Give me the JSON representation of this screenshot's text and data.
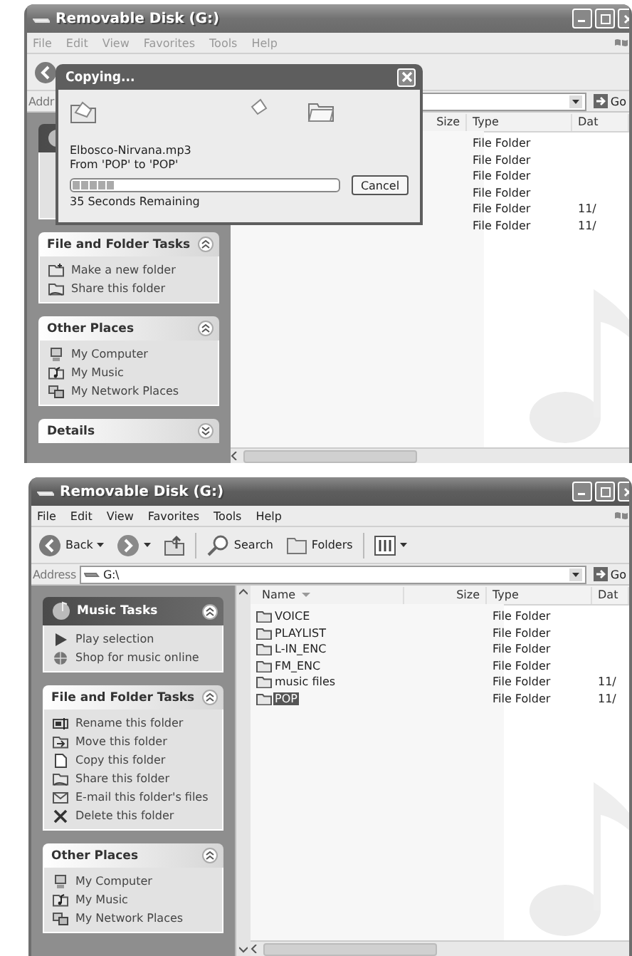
{
  "windows": [
    {
      "title": "Removable Disk (G:)",
      "active": false,
      "menu": [
        "File",
        "Edit",
        "View",
        "Favorites",
        "Tools",
        "Help"
      ],
      "toolbar": [
        {
          "kind": "back"
        }
      ],
      "address": {
        "label": "Addr",
        "go": "Go"
      },
      "task_panels": [
        {
          "kind": "special"
        },
        {
          "kind": "normal",
          "title": "File and Folder Tasks",
          "expanded": true,
          "items": [
            {
              "kind": "newfolder",
              "label": "Make a new folder"
            },
            {
              "kind": "share",
              "label": "Share this folder"
            }
          ]
        },
        {
          "kind": "normal",
          "title": "Other Places",
          "expanded": true,
          "items": [
            {
              "kind": "computer",
              "label": "My Computer"
            },
            {
              "kind": "music",
              "label": "My Music"
            },
            {
              "kind": "network",
              "label": "My Network Places"
            }
          ]
        },
        {
          "kind": "normal",
          "title": "Details",
          "expanded": false
        }
      ],
      "columns": [
        {
          "kind": "size",
          "label": "Size",
          "sorted": false
        },
        {
          "kind": "type",
          "label": "Type",
          "sorted": false
        },
        {
          "kind": "date",
          "label": "Dat",
          "sorted": false
        }
      ],
      "rows": [
        {
          "type": "File Folder"
        },
        {
          "type": "File Folder"
        },
        {
          "type": "File Folder"
        },
        {
          "type": "File Folder"
        },
        {
          "type": "File Folder",
          "date": "11/"
        },
        {
          "type": "File Folder",
          "date": "11/"
        }
      ]
    },
    {
      "title": "Removable Disk (G:)",
      "active": true,
      "menu": [
        "File",
        "Edit",
        "View",
        "Favorites",
        "Tools",
        "Help"
      ],
      "toolbar": [
        {
          "kind": "back",
          "label": "Back"
        },
        {
          "kind": "forward"
        },
        {
          "kind": "up"
        },
        {
          "kind": "search",
          "label": "Search"
        },
        {
          "kind": "folders",
          "label": "Folders"
        },
        {
          "kind": "views"
        }
      ],
      "address": {
        "label": "Address",
        "value": "G:\\",
        "go": "Go"
      },
      "left_scrollbar": true,
      "task_panels": [
        {
          "kind": "special",
          "title": "Music Tasks",
          "expanded": true,
          "items": [
            {
              "kind": "play",
              "label": "Play selection"
            },
            {
              "kind": "shop",
              "label": "Shop for music online"
            }
          ]
        },
        {
          "kind": "normal",
          "title": "File and Folder Tasks",
          "expanded": true,
          "items": [
            {
              "kind": "rename",
              "label": "Rename this folder"
            },
            {
              "kind": "move",
              "label": "Move this folder"
            },
            {
              "kind": "copy",
              "label": "Copy this folder"
            },
            {
              "kind": "share",
              "label": "Share this folder"
            },
            {
              "kind": "email",
              "label": "E-mail this folder's files"
            },
            {
              "kind": "delete",
              "label": "Delete this folder"
            }
          ]
        },
        {
          "kind": "normal",
          "title": "Other Places",
          "expanded": true,
          "items": [
            {
              "kind": "computer",
              "label": "My Computer"
            },
            {
              "kind": "music",
              "label": "My Music"
            },
            {
              "kind": "network",
              "label": "My Network Places"
            }
          ]
        }
      ],
      "columns": [
        {
          "kind": "name",
          "label": "Name",
          "sorted": true
        },
        {
          "kind": "size",
          "label": "Size",
          "sorted": false
        },
        {
          "kind": "type",
          "label": "Type",
          "sorted": false
        },
        {
          "kind": "date",
          "label": "Dat",
          "sorted": false
        }
      ],
      "rows": [
        {
          "name": "VOICE",
          "type": "File Folder",
          "selected": false
        },
        {
          "name": "PLAYLIST",
          "type": "File Folder",
          "selected": false
        },
        {
          "name": "L-IN_ENC",
          "type": "File Folder",
          "selected": false
        },
        {
          "name": "FM_ENC",
          "type": "File Folder",
          "selected": false
        },
        {
          "name": "music files",
          "type": "File Folder",
          "date": "11/",
          "selected": false
        },
        {
          "name": "POP",
          "type": "File Folder",
          "date": "11/",
          "selected": true
        }
      ]
    }
  ],
  "copy_dialog": {
    "title": "Copying...",
    "file": "Elbosco-Nirvana.mp3",
    "from_to": "From 'POP' to 'POP'",
    "progress": {
      "level": 0.16
    },
    "cancel": "Cancel",
    "remaining": "35 Seconds Remaining"
  }
}
